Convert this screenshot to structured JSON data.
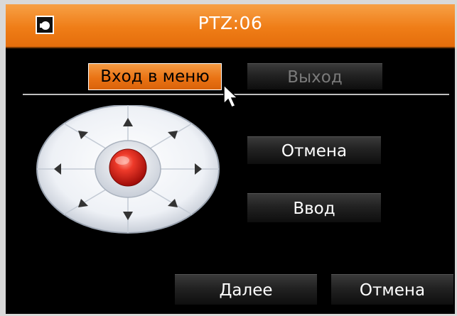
{
  "title": "PTZ:06",
  "header": {
    "icon": "camera-icon"
  },
  "buttons": {
    "menu_enter": "Вход в меню",
    "exit": "Выход",
    "cancel_top": "Отмена",
    "enter": "Ввод",
    "next": "Далее",
    "cancel_bottom": "Отмена"
  },
  "dpad": {
    "directions": [
      "up",
      "up-right",
      "right",
      "down-right",
      "down",
      "down-left",
      "left",
      "up-left"
    ],
    "center": "center-button"
  },
  "colors": {
    "accent": "#ef7d17",
    "background": "#000000",
    "button": "#222222",
    "center_button": "#d8201a"
  }
}
